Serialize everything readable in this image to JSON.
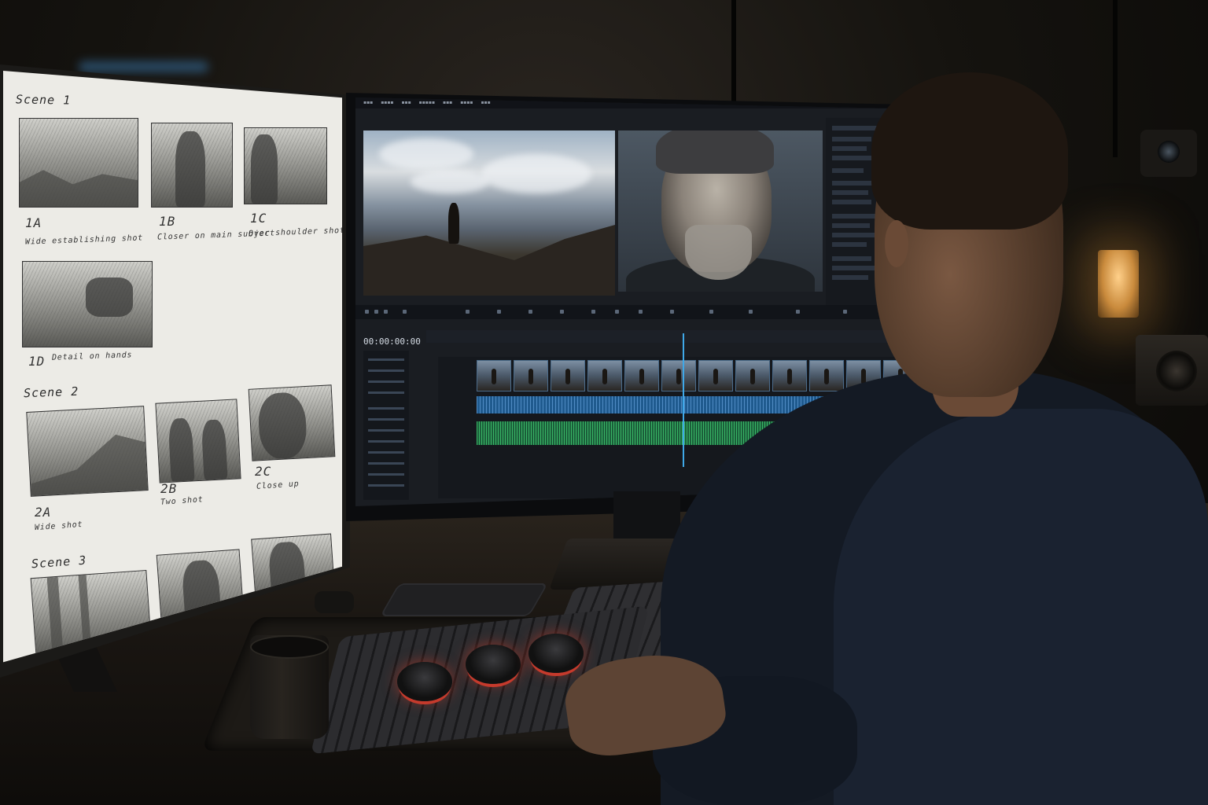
{
  "storyboard": {
    "scenes": [
      {
        "title": "Scene 1",
        "shots": [
          {
            "id": "1A",
            "caption": "Wide establishing shot"
          },
          {
            "id": "1B",
            "caption": "Closer on main subject"
          },
          {
            "id": "1C",
            "caption": "Over shoulder shot"
          },
          {
            "id": "1D",
            "caption": "Detail on hands"
          }
        ]
      },
      {
        "title": "Scene 2",
        "shots": [
          {
            "id": "2A",
            "caption": "Wide shot"
          },
          {
            "id": "2B",
            "caption": "Two shot"
          },
          {
            "id": "2C",
            "caption": "Close up"
          }
        ]
      },
      {
        "title": "Scene 3",
        "shots": []
      }
    ]
  },
  "editor": {
    "timecode": "00:00:00:00",
    "accent_colors": {
      "playhead": "#3fa8e8",
      "video_track": "#4b6b8a",
      "audio_track_1": "#1f5a8e",
      "audio_track_2": "#1b5e3a"
    }
  }
}
